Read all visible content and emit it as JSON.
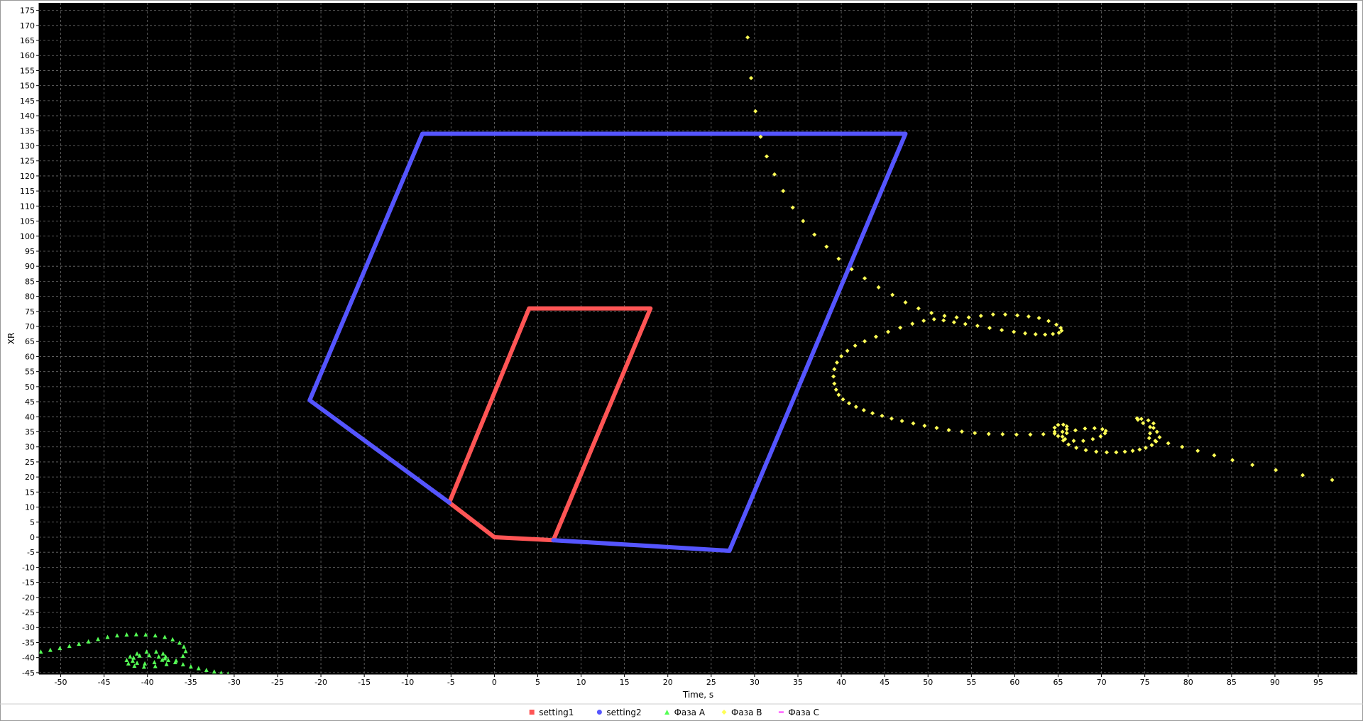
{
  "chart_data": {
    "type": "scatter",
    "title": "",
    "xlabel": "Time, s",
    "ylabel": "XR",
    "xlim": [
      -52.5,
      99.5
    ],
    "ylim": [
      -45.5,
      177.5
    ],
    "x_ticks": [
      -50,
      -45,
      -40,
      -35,
      -30,
      -25,
      -20,
      -15,
      -10,
      -5,
      0,
      5,
      10,
      15,
      20,
      25,
      30,
      35,
      40,
      45,
      50,
      55,
      60,
      65,
      70,
      75,
      80,
      85,
      90,
      95
    ],
    "y_ticks": [
      175,
      170,
      165,
      160,
      155,
      150,
      145,
      140,
      135,
      130,
      125,
      120,
      115,
      110,
      105,
      100,
      95,
      90,
      85,
      80,
      75,
      70,
      65,
      60,
      55,
      50,
      45,
      40,
      35,
      30,
      25,
      20,
      15,
      10,
      5,
      0,
      -5,
      -10,
      -15,
      -20,
      -25,
      -30,
      -35,
      -40,
      -45
    ],
    "grid": true,
    "background": "#000000",
    "legend_position": "bottom-center",
    "series": [
      {
        "name": "setting1",
        "style": "line",
        "marker": "square",
        "color": "#ff5555",
        "x": [
          0,
          6.8,
          18.0,
          4.0,
          -5.2,
          0
        ],
        "y": [
          0,
          -1.0,
          76.0,
          76.0,
          11.5,
          0
        ]
      },
      {
        "name": "setting2",
        "style": "line",
        "marker": "circle",
        "color": "#5555ff",
        "x": [
          -5.2,
          -21.3,
          -8.3,
          47.4,
          27.1,
          6.8
        ],
        "y": [
          11.5,
          45.5,
          134.0,
          134.0,
          -4.5,
          -1.0
        ]
      },
      {
        "name": "Фаза А",
        "style": "points",
        "marker": "triangle",
        "color": "#55ff55",
        "x": [
          -52.3,
          -51.2,
          -50.1,
          -49.0,
          -47.9,
          -46.8,
          -45.7,
          -44.6,
          -43.5,
          -42.4,
          -41.3,
          -40.2,
          -39.1,
          -38.0,
          -37.1,
          -36.3,
          -35.8,
          -35.6,
          -35.9,
          -36.7,
          -37.8,
          -39.1,
          -40.4,
          -41.5,
          -42.2,
          -42.4,
          -42.0,
          -41.2,
          -40.1,
          -39.0,
          -38.2,
          -37.9,
          -38.3,
          -39.2,
          -40.3,
          -41.2,
          -41.7,
          -41.6,
          -40.9,
          -39.8,
          -38.7,
          -38.0,
          -37.6,
          -36.8,
          -35.9,
          -35.0,
          -34.1,
          -33.2,
          -32.3,
          -31.5,
          -30.7
        ],
        "y": [
          -38.0,
          -37.4,
          -36.8,
          -36.1,
          -35.4,
          -34.6,
          -33.8,
          -33.1,
          -32.6,
          -32.3,
          -32.2,
          -32.3,
          -32.6,
          -33.1,
          -33.9,
          -35.0,
          -36.3,
          -37.8,
          -39.4,
          -40.9,
          -42.1,
          -42.8,
          -43.0,
          -42.7,
          -41.9,
          -40.8,
          -39.6,
          -38.6,
          -38.0,
          -38.0,
          -38.6,
          -39.6,
          -40.7,
          -41.5,
          -41.9,
          -41.7,
          -41.0,
          -40.0,
          -39.3,
          -39.2,
          -39.6,
          -40.2,
          -40.8,
          -41.5,
          -42.2,
          -42.9,
          -43.5,
          -44.1,
          -44.6,
          -45.0,
          -45.3
        ]
      },
      {
        "name": "Фаза B",
        "style": "points",
        "marker": "diamond",
        "color": "#ffff55",
        "x": [
          29.2,
          29.6,
          30.1,
          30.7,
          31.4,
          32.3,
          33.3,
          34.4,
          35.6,
          36.9,
          38.3,
          39.7,
          41.2,
          42.7,
          44.3,
          45.9,
          47.4,
          48.9,
          50.4,
          51.9,
          53.3,
          54.7,
          56.1,
          57.5,
          58.9,
          60.3,
          61.6,
          62.8,
          63.9,
          64.8,
          65.3,
          65.4,
          65.1,
          64.4,
          63.5,
          62.4,
          61.2,
          59.9,
          58.5,
          57.1,
          55.7,
          54.3,
          53.0,
          51.8,
          50.7,
          49.5,
          48.2,
          46.8,
          45.4,
          44.0,
          42.7,
          41.6,
          40.7,
          40.0,
          39.5,
          39.2,
          39.1,
          39.2,
          39.4,
          39.7,
          40.2,
          40.9,
          41.7,
          42.6,
          43.6,
          44.7,
          45.8,
          47.0,
          48.3,
          49.6,
          51.0,
          52.4,
          53.9,
          55.4,
          57.0,
          58.6,
          60.2,
          61.8,
          63.3,
          64.6,
          65.5,
          66.0,
          66.0,
          65.6,
          65.0,
          64.6,
          64.6,
          65.0,
          65.8,
          66.8,
          67.9,
          69.0,
          69.9,
          70.4,
          70.5,
          70.1,
          69.2,
          68.1,
          67.0,
          66.0,
          65.5,
          65.6,
          66.2,
          67.1,
          68.2,
          69.4,
          70.6,
          71.7,
          72.7,
          73.6,
          74.4,
          75.1,
          75.8,
          76.3,
          76.7,
          76.4,
          75.6,
          74.8,
          74.2,
          74.1,
          74.6,
          75.4,
          76.0,
          76.0,
          75.6,
          75.5,
          76.2,
          77.7,
          79.3,
          81.1,
          83.0,
          85.1,
          87.4,
          90.1,
          93.2,
          96.6
        ],
        "y": [
          166.0,
          152.5,
          141.5,
          133.0,
          126.5,
          120.5,
          115.0,
          109.5,
          105.0,
          100.5,
          96.5,
          92.5,
          89.0,
          86.0,
          83.0,
          80.5,
          78.0,
          76.0,
          74.5,
          73.5,
          73.0,
          73.0,
          73.5,
          74.0,
          74.0,
          73.7,
          73.3,
          72.8,
          71.8,
          70.6,
          69.5,
          68.6,
          67.9,
          67.5,
          67.3,
          67.4,
          67.7,
          68.2,
          68.8,
          69.5,
          70.2,
          70.8,
          71.4,
          72.0,
          72.4,
          71.9,
          70.9,
          69.6,
          68.2,
          66.6,
          65.1,
          63.6,
          61.9,
          60.1,
          58.0,
          55.8,
          53.4,
          51.0,
          49.0,
          47.3,
          45.8,
          44.5,
          43.3,
          42.2,
          41.2,
          40.3,
          39.4,
          38.6,
          37.8,
          37.0,
          36.3,
          35.6,
          35.1,
          34.6,
          34.3,
          34.2,
          34.1,
          34.1,
          34.2,
          34.4,
          35.0,
          35.9,
          36.8,
          37.4,
          37.3,
          36.4,
          35.0,
          33.6,
          32.6,
          32.0,
          32.0,
          32.6,
          33.5,
          34.5,
          35.3,
          35.9,
          36.2,
          36.1,
          35.5,
          34.6,
          33.4,
          32.1,
          30.8,
          29.7,
          28.9,
          28.4,
          28.2,
          28.2,
          28.4,
          28.7,
          29.1,
          29.7,
          30.6,
          31.8,
          33.2,
          35.0,
          36.6,
          37.9,
          39.0,
          39.5,
          39.3,
          38.8,
          37.8,
          36.3,
          34.5,
          32.9,
          32.0,
          31.2,
          30.0,
          28.7,
          27.2,
          25.6,
          24.0,
          22.3,
          20.6,
          19.0
        ]
      },
      {
        "name": "Фаза C",
        "style": "points",
        "marker": "dash",
        "color": "#ff55ff",
        "x": [],
        "y": []
      }
    ]
  }
}
